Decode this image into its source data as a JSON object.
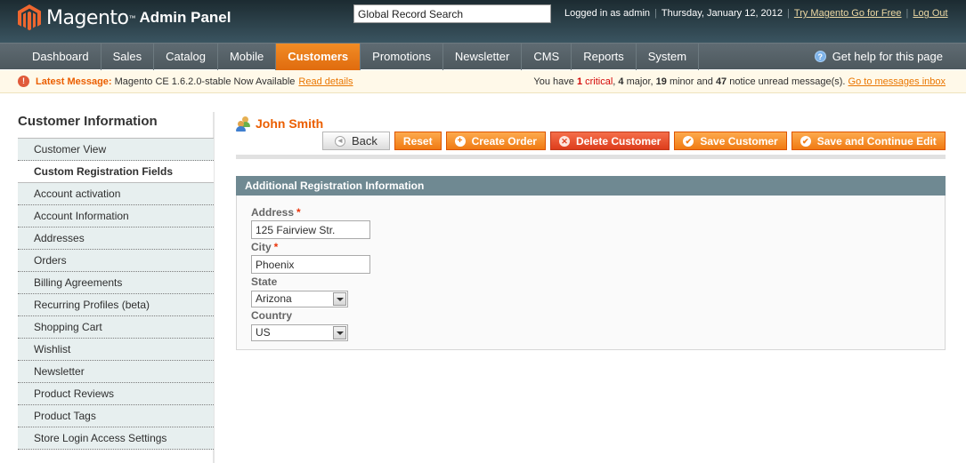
{
  "header": {
    "brand": "Magento",
    "trademark": "™",
    "subtitle": "Admin Panel",
    "search_value": "Global Record Search",
    "logged_in": "Logged in as admin",
    "date": "Thursday, January 12, 2012",
    "try_link": "Try Magento Go for Free",
    "logout_link": "Log Out",
    "separator": "|"
  },
  "nav": {
    "items": [
      {
        "label": "Dashboard",
        "active": false
      },
      {
        "label": "Sales",
        "active": false
      },
      {
        "label": "Catalog",
        "active": false
      },
      {
        "label": "Mobile",
        "active": false
      },
      {
        "label": "Customers",
        "active": true
      },
      {
        "label": "Promotions",
        "active": false
      },
      {
        "label": "Newsletter",
        "active": false
      },
      {
        "label": "CMS",
        "active": false
      },
      {
        "label": "Reports",
        "active": false
      },
      {
        "label": "System",
        "active": false
      }
    ],
    "help_icon": "question-circle-icon",
    "help_label": "Get help for this page"
  },
  "notice": {
    "icon": "exclamation-circle-icon",
    "label": "Latest Message:",
    "message": "Magento CE 1.6.2.0-stable Now Available",
    "link": "Read details",
    "summary_prefix": "You have",
    "critical_count": "1",
    "critical_label": "critical",
    "major_count": "4",
    "major_label": "major,",
    "minor_count": "19",
    "minor_label": "minor and",
    "notice_count": "47",
    "notice_label": "notice unread message(s).",
    "inbox_link": "Go to messages inbox"
  },
  "sidebar": {
    "title": "Customer Information",
    "items": [
      {
        "label": "Customer View",
        "active": false
      },
      {
        "label": "Custom Registration Fields",
        "active": true
      },
      {
        "label": "Account activation",
        "active": false
      },
      {
        "label": "Account Information",
        "active": false
      },
      {
        "label": "Addresses",
        "active": false
      },
      {
        "label": "Orders",
        "active": false
      },
      {
        "label": "Billing Agreements",
        "active": false
      },
      {
        "label": "Recurring Profiles (beta)",
        "active": false
      },
      {
        "label": "Shopping Cart",
        "active": false
      },
      {
        "label": "Wishlist",
        "active": false
      },
      {
        "label": "Newsletter",
        "active": false
      },
      {
        "label": "Product Reviews",
        "active": false
      },
      {
        "label": "Product Tags",
        "active": false
      },
      {
        "label": "Store Login Access Settings",
        "active": false
      }
    ]
  },
  "main": {
    "title_icon": "customer-group-icon",
    "title": "John Smith",
    "buttons": {
      "back": "Back",
      "reset": "Reset",
      "create_order": "Create Order",
      "delete": "Delete Customer",
      "save": "Save Customer",
      "save_continue": "Save and Continue Edit"
    },
    "fieldset": {
      "title": "Additional Registration Information",
      "fields": {
        "address": {
          "label": "Address",
          "required": "*",
          "value": "125 Fairview Str."
        },
        "city": {
          "label": "City",
          "required": "*",
          "value": "Phoenix"
        },
        "state": {
          "label": "State",
          "value": "Arizona"
        },
        "country": {
          "label": "Country",
          "value": "US"
        }
      }
    }
  },
  "colors": {
    "accent_orange": "#eb5e00",
    "nav_active": "#f07a12",
    "fieldset_header": "#6f8992",
    "critical": "#d40707"
  }
}
